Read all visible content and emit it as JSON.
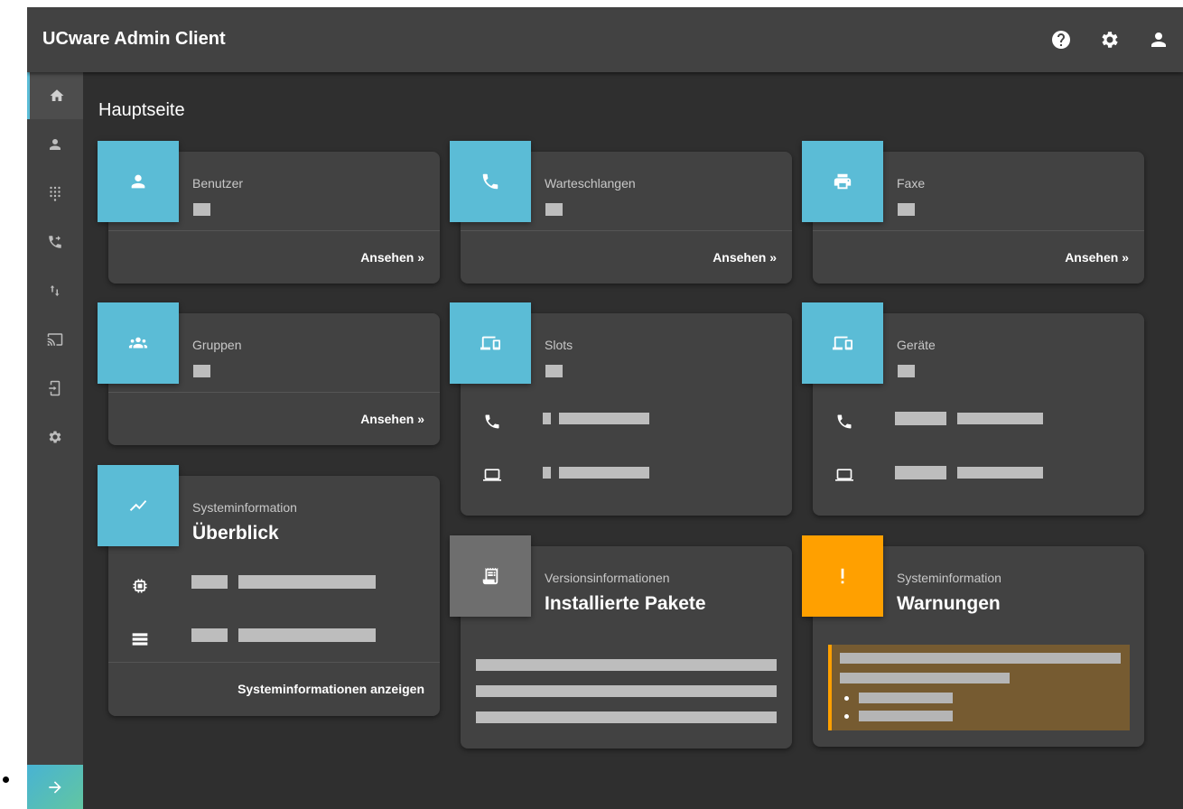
{
  "header": {
    "title": "UCware Admin Client",
    "icons": [
      "help-icon",
      "settings-icon",
      "account-icon"
    ]
  },
  "sidebar": {
    "items": [
      {
        "icon": "home-icon",
        "active": true
      },
      {
        "icon": "user-icon"
      },
      {
        "icon": "dialpad-icon"
      },
      {
        "icon": "phone-forward-icon"
      },
      {
        "icon": "transfer-arrows-icon"
      },
      {
        "icon": "cast-icon"
      },
      {
        "icon": "device-login-icon"
      },
      {
        "icon": "settings-icon"
      }
    ],
    "expand_icon": "arrow-right-icon"
  },
  "page": {
    "title": "Hauptseite"
  },
  "cards": {
    "benutzer": {
      "label": "Benutzer",
      "link": "Ansehen »",
      "icon": "user-icon"
    },
    "warteschlangen": {
      "label": "Warteschlangen",
      "link": "Ansehen »",
      "icon": "phone-icon"
    },
    "faxe": {
      "label": "Faxe",
      "link": "Ansehen »",
      "icon": "printer-icon"
    },
    "gruppen": {
      "label": "Gruppen",
      "link": "Ansehen »",
      "icon": "group-icon"
    },
    "slots": {
      "label": "Slots",
      "icon": "devices-icon",
      "rows": [
        "phone-icon",
        "laptop-icon"
      ]
    },
    "geraete": {
      "label": "Geräte",
      "icon": "devices-icon",
      "rows": [
        "phone-icon",
        "laptop-icon"
      ]
    },
    "systeminfo": {
      "label": "Systeminformation",
      "heading": "Überblick",
      "link": "Systeminformationen anzeigen",
      "icon": "trend-icon",
      "rows": [
        "cpu-icon",
        "storage-icon"
      ]
    },
    "versionen": {
      "label": "Versionsinformationen",
      "heading": "Installierte Pakete",
      "icon": "receipt-icon"
    },
    "warnungen": {
      "label": "Systeminformation",
      "heading": "Warnungen",
      "icon": "exclamation-icon"
    }
  },
  "colors": {
    "accent": "#5bbcd6",
    "warning": "#ffa000",
    "card": "#424242",
    "background": "#2f2f2f"
  }
}
